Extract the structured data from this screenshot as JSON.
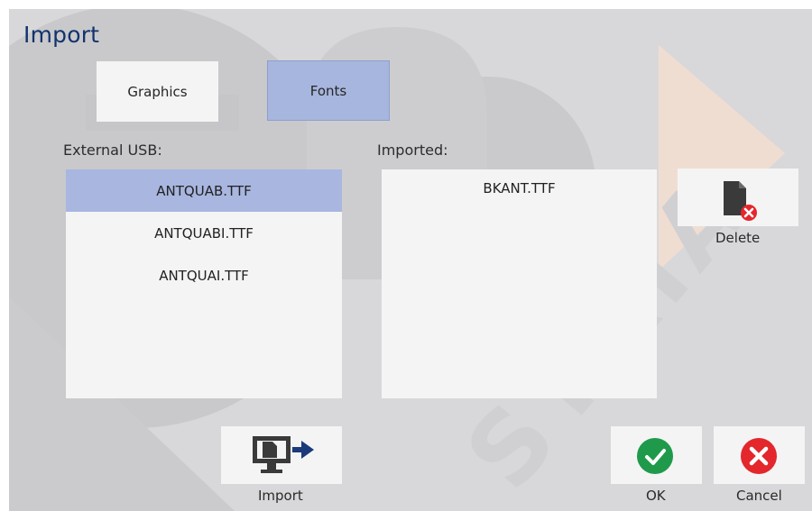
{
  "window": {
    "title": "Import"
  },
  "tabs": [
    {
      "label": "Graphics",
      "selected": false
    },
    {
      "label": "Fonts",
      "selected": true
    }
  ],
  "external_usb": {
    "label": "External USB:",
    "items": [
      "ANTQUAB.TTF",
      "ANTQUABI.TTF",
      "ANTQUAI.TTF"
    ],
    "selected_index": 0
  },
  "imported": {
    "label": "Imported:",
    "items": [
      "BKANT.TTF"
    ]
  },
  "buttons": {
    "delete_label": "Delete",
    "import_label": "Import",
    "ok_label": "OK",
    "cancel_label": "Cancel"
  },
  "colors": {
    "title": "#13336e",
    "selection": "#a8b6e0",
    "ok_green": "#1f9a4a",
    "cancel_red": "#e3272c",
    "icon_dark": "#3a3a3a",
    "import_arrow": "#1b3a7a"
  },
  "icons": {
    "delete": "file-delete-icon",
    "import": "monitor-file-import-icon",
    "ok": "check-circle-icon",
    "cancel": "x-circle-icon"
  }
}
